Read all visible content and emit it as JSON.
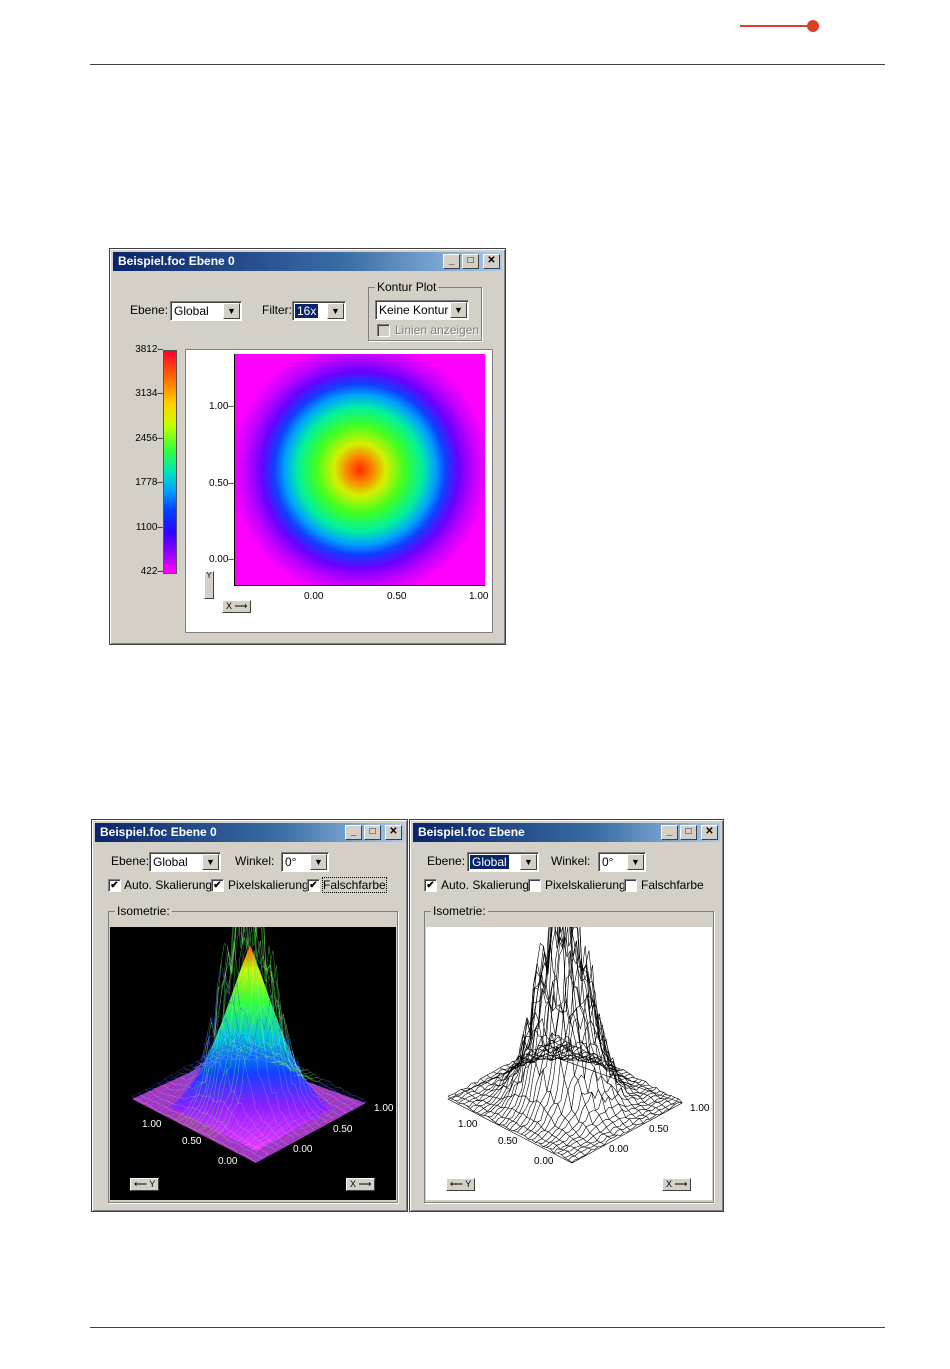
{
  "page": {
    "accent_color": "#d9402a"
  },
  "window1": {
    "title": "Beispiel.foc Ebene 0",
    "ebene_label": "Ebene:",
    "ebene_value": "Global",
    "filter_label": "Filter:",
    "filter_value": "16x",
    "kontur_group": "Kontur Plot",
    "kontur_value": "Keine Kontur",
    "linien_label": "Linien anzeigen",
    "colorbar_ticks": [
      "3812",
      "3134",
      "2456",
      "1778",
      "1100",
      "422"
    ],
    "y_ticks": [
      "1.00",
      "0.50",
      "0.00"
    ],
    "x_ticks": [
      "0.00",
      "0.50",
      "1.00"
    ],
    "y_axis_button": "Y",
    "x_axis_button": "X ⟶"
  },
  "window2": {
    "title": "Beispiel.foc Ebene 0",
    "ebene_label": "Ebene:",
    "ebene_value": "Global",
    "winkel_label": "Winkel:",
    "winkel_value": "0°",
    "auto_label": "Auto. Skalierung",
    "auto_checked": "✔",
    "pixel_label": "Pixelskalierung",
    "pixel_checked": "✔",
    "falsch_label": "Falschfarbe",
    "falsch_checked": "✔",
    "group_title": "Isometrie:",
    "y_button": "⟵ Y",
    "x_button": "X ⟶",
    "iso_labels": {
      "left_100": "1.00",
      "left_050": "0.50",
      "origin": "0.00",
      "right_000": "0.00",
      "right_050": "0.50",
      "right_100": "1.00"
    }
  },
  "window3": {
    "title": "Beispiel.foc Ebene",
    "ebene_label": "Ebene:",
    "ebene_value": "Global",
    "winkel_label": "Winkel:",
    "winkel_value": "0°",
    "auto_label": "Auto. Skalierung",
    "auto_checked": "✔",
    "pixel_label": "Pixelskalierung",
    "pixel_checked": "",
    "falsch_label": "Falschfarbe",
    "falsch_checked": "",
    "group_title": "Isometrie:",
    "y_button": "⟵ Y",
    "x_button": "X ⟶",
    "iso_labels": {
      "left_100": "1.00",
      "left_050": "0.50",
      "origin": "0.00",
      "right_000": "0.00",
      "right_050": "0.50",
      "right_100": "1.00"
    }
  },
  "icons": {
    "minimize": "_",
    "maximize": "□",
    "close": "✕",
    "dropdown": "▼"
  }
}
